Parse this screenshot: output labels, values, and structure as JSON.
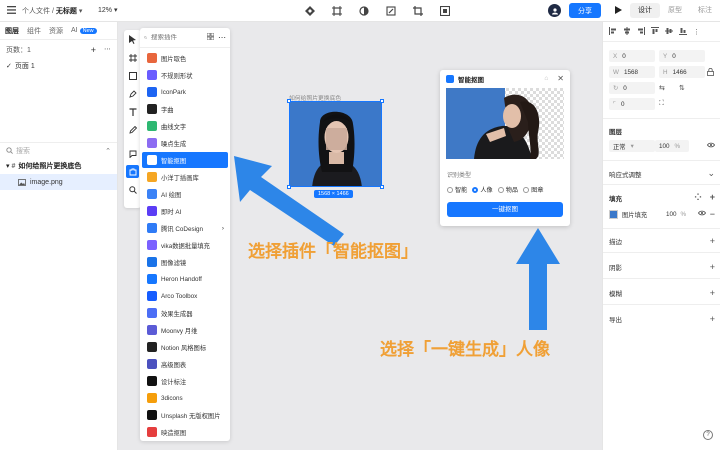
{
  "topbar": {
    "breadcrumb_folder": "个人文件",
    "breadcrumb_sep": "/",
    "breadcrumb_doc": "无标题",
    "zoom": "12%",
    "share_label": "分享",
    "mode_tabs": [
      "设计",
      "原型",
      "标注"
    ]
  },
  "left_panel": {
    "tabs": [
      "图层",
      "组件",
      "资源",
      "AI"
    ],
    "ai_badge": "New",
    "pages_label": "页数：1",
    "page_item": "页面 1",
    "search_placeholder": "搜索",
    "frame_name": "如何给照片更换底色",
    "image_name": "image.png"
  },
  "plugin_list": {
    "search_placeholder": "搜索插件",
    "items": [
      {
        "label": "图片取色",
        "color": "#e8663d"
      },
      {
        "label": "不规则形状",
        "color": "#6a5cff"
      },
      {
        "label": "IconPark",
        "color": "#1d64f2"
      },
      {
        "label": "字曲",
        "color": "#222222"
      },
      {
        "label": "曲线文字",
        "color": "#2eb872"
      },
      {
        "label": "噪点生成",
        "color": "#8c6cf2"
      },
      {
        "label": "智能抠图",
        "color": "#1677ff"
      },
      {
        "label": "小洋丁插画库",
        "color": "#f5a623"
      },
      {
        "label": "AI 绘图",
        "color": "#3b82f6"
      },
      {
        "label": "即时 AI",
        "color": "#5b3df5"
      },
      {
        "label": "腾讯 CoDesign",
        "color": "#2f7bf6"
      },
      {
        "label": "vika数据批量填充",
        "color": "#7b61ff"
      },
      {
        "label": "图像滤镜",
        "color": "#1a73e8"
      },
      {
        "label": "Heron Handoff",
        "color": "#1677ff"
      },
      {
        "label": "Arco Toolbox",
        "color": "#165dff"
      },
      {
        "label": "效果生成器",
        "color": "#4c6ef5"
      },
      {
        "label": "Moonvy 月维",
        "color": "#5b5bd6"
      },
      {
        "label": "Notion 风格图标",
        "color": "#222222"
      },
      {
        "label": "高级图表",
        "color": "#4c51bf"
      },
      {
        "label": "设计标注",
        "color": "#111111"
      },
      {
        "label": "3dicons",
        "color": "#f59e0b"
      },
      {
        "label": "Unsplash 无版权图片",
        "color": "#111111"
      },
      {
        "label": "映造抠图",
        "color": "#e53e3e"
      }
    ],
    "active_index": 6,
    "submenu_index": 10
  },
  "canvas": {
    "frame_label": "如何给照片更换底色",
    "size_badge": "1568 × 1466"
  },
  "dialog": {
    "title": "智能抠图",
    "sub_label": "识别类型",
    "options": [
      "智能",
      "人像",
      "物品",
      "图章"
    ],
    "selected_option": 1,
    "button_label": "一键抠图"
  },
  "annotations": {
    "left": "选择插件「智能抠图」",
    "bottom": "选择「一键生成」人像"
  },
  "right_panel": {
    "x_label": "X",
    "x_value": "0",
    "y_label": "Y",
    "y_value": "0",
    "w_label": "W",
    "w_value": "1568",
    "h_label": "H",
    "h_value": "1466",
    "rotation": "0",
    "radius": "0",
    "layer_title": "图层",
    "blend_mode": "正常",
    "opacity": "100",
    "opacity_unit": "%",
    "responsive": "响应式调整",
    "fill_title": "填充",
    "fill_type": "图片填充",
    "fill_opacity": "100",
    "sections": [
      "描边",
      "阴影",
      "模糊",
      "导出"
    ]
  }
}
